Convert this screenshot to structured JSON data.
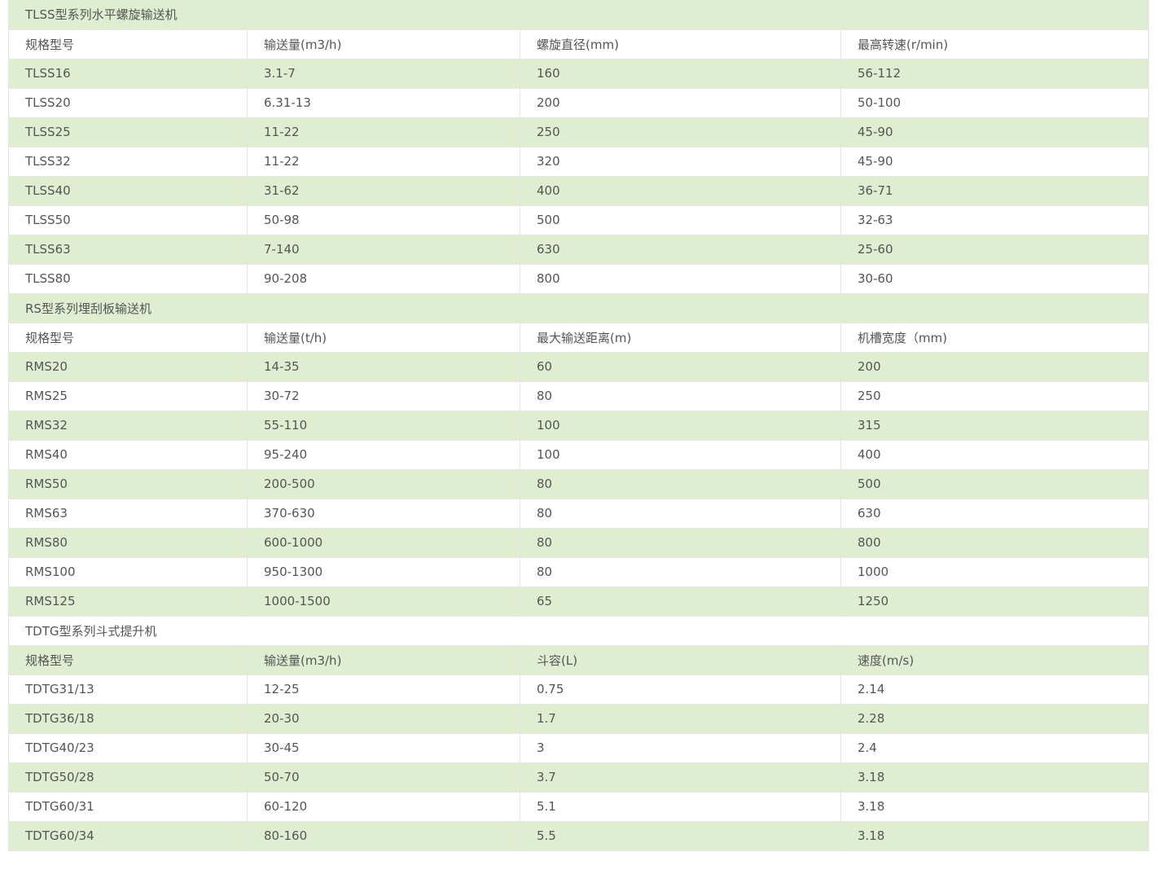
{
  "sections": [
    {
      "title": "TLSS型系列水平螺旋输送机",
      "headers": [
        "规格型号",
        "输送量(m3/h)",
        "螺旋直径(mm)",
        "最高转速(r/min)"
      ],
      "rows": [
        [
          "TLSS16",
          "3.1-7",
          "160",
          "56-112"
        ],
        [
          "TLSS20",
          "6.31-13",
          "200",
          "50-100"
        ],
        [
          "TLSS25",
          "11-22",
          "250",
          "45-90"
        ],
        [
          "TLSS32",
          "11-22",
          "320",
          "45-90"
        ],
        [
          "TLSS40",
          "31-62",
          "400",
          "36-71"
        ],
        [
          "TLSS50",
          "50-98",
          "500",
          "32-63"
        ],
        [
          "TLSS63",
          "7-140",
          "630",
          "25-60"
        ],
        [
          "TLSS80",
          "90-208",
          "800",
          "30-60"
        ]
      ]
    },
    {
      "title": "RS型系列埋刮板输送机",
      "headers": [
        "规格型号",
        "输送量(t/h)",
        "最大输送距离(m)",
        "机槽宽度（mm)"
      ],
      "rows": [
        [
          "RMS20",
          "14-35",
          "60",
          "200"
        ],
        [
          "RMS25",
          "30-72",
          "80",
          "250"
        ],
        [
          "RMS32",
          "55-110",
          "100",
          "315"
        ],
        [
          "RMS40",
          "95-240",
          "100",
          "400"
        ],
        [
          "RMS50",
          "200-500",
          "80",
          "500"
        ],
        [
          "RMS63",
          "370-630",
          "80",
          "630"
        ],
        [
          "RMS80",
          "600-1000",
          "80",
          "800"
        ],
        [
          "RMS100",
          "950-1300",
          "80",
          "1000"
        ],
        [
          "RMS125",
          "1000-1500",
          "65",
          "1250"
        ]
      ]
    },
    {
      "title": "TDTG型系列斗式提升机",
      "headers": [
        "规格型号",
        "输送量(m3/h)",
        "斗容(L)",
        "速度(m/s)"
      ],
      "rows": [
        [
          "TDTG31/13",
          "12-25",
          "0.75",
          "2.14"
        ],
        [
          "TDTG36/18",
          "20-30",
          "1.7",
          "2.28"
        ],
        [
          "TDTG40/23",
          "30-45",
          "3",
          "2.4"
        ],
        [
          "TDTG50/28",
          "50-70",
          "3.7",
          "3.18"
        ],
        [
          "TDTG60/31",
          "60-120",
          "5.1",
          "3.18"
        ],
        [
          "TDTG60/34",
          "80-160",
          "5.5",
          "3.18"
        ]
      ]
    }
  ],
  "colors": {
    "stripe": "#dfeed1",
    "border": "#e4e4e4",
    "text": "#555555"
  }
}
